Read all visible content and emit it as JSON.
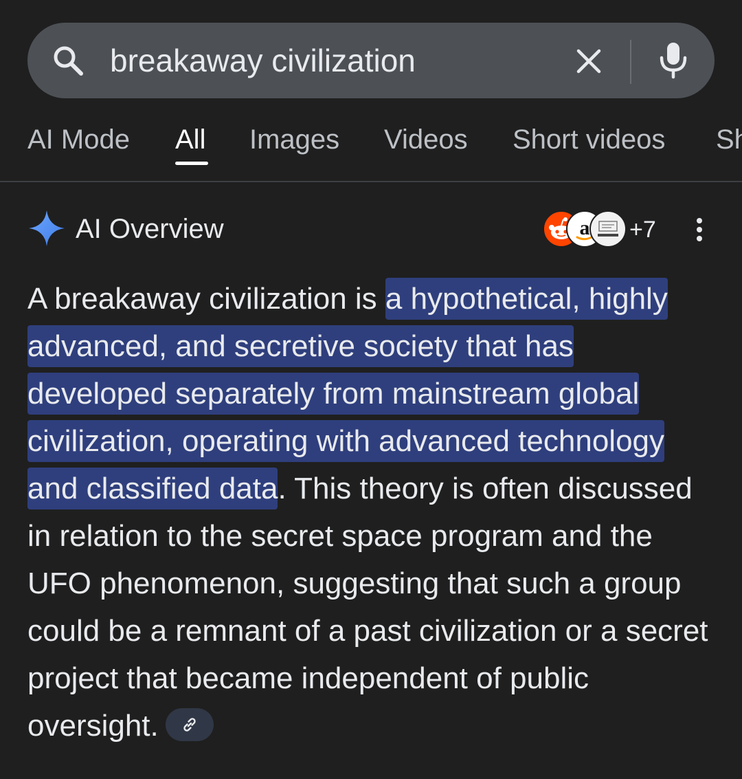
{
  "search": {
    "query": "breakaway civilization",
    "icons": {
      "search": "search-icon",
      "clear": "close-icon",
      "mic": "mic-icon"
    }
  },
  "tabs": [
    {
      "label": "AI Mode",
      "active": false
    },
    {
      "label": "All",
      "active": true
    },
    {
      "label": "Images",
      "active": false
    },
    {
      "label": "Videos",
      "active": false
    },
    {
      "label": "Short videos",
      "active": false
    },
    {
      "label": "Sh",
      "active": false
    }
  ],
  "ai_overview": {
    "title": "AI Overview",
    "source_count": "+7",
    "sources": [
      "reddit-logo",
      "amazon-logo",
      "site-logo"
    ],
    "text": {
      "intro": "A breakaway civilization is ",
      "highlight": "a hypothetical, highly advanced, and secretive society that has developed separately from mainstream global civilization, operating with advanced technology and classified data",
      "rest": ". This theory is often discussed in relation to the secret space program and the UFO phenomenon, suggesting that such a group could be a remnant of a past civilization or a secret project that became independent of public oversight."
    }
  },
  "colors": {
    "background": "#1f1f1f",
    "search_bar": "#4d5156",
    "highlight": "#2f3f7d",
    "accent_spark": "#4c8df6"
  }
}
